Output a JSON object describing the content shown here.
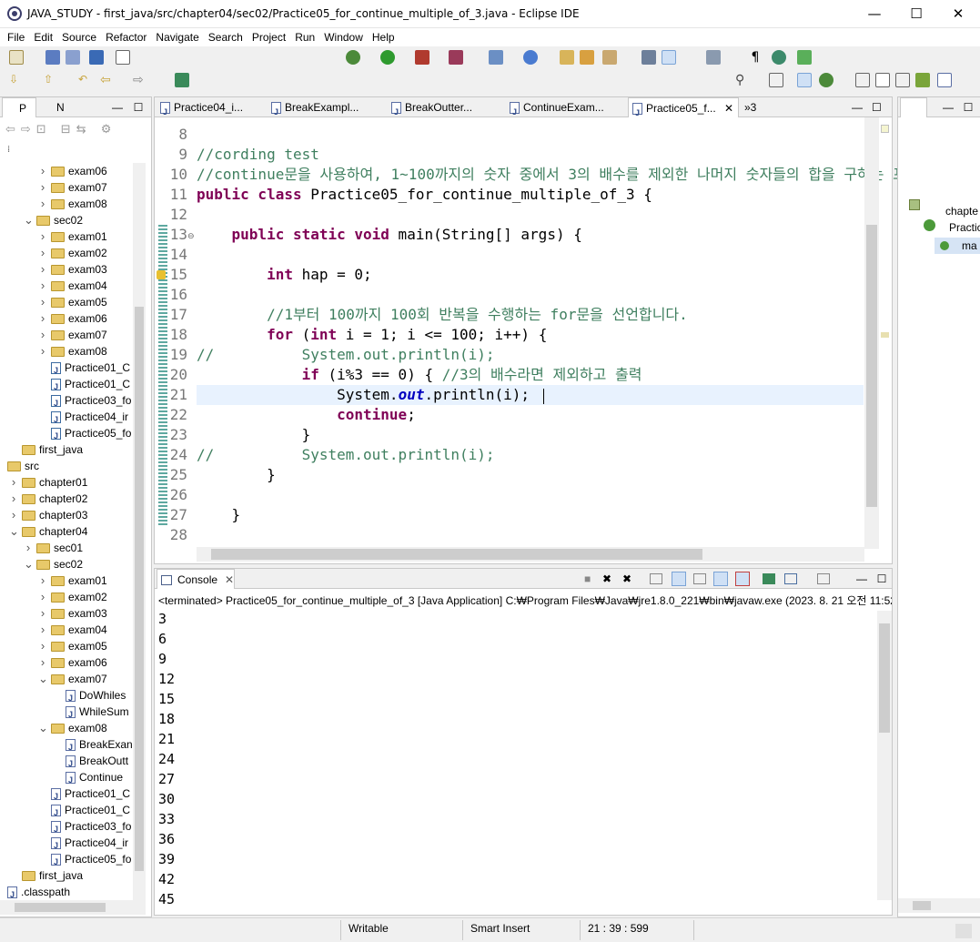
{
  "window": {
    "title": "JAVA_STUDY - first_java/src/chapter04/sec02/Practice05_for_continue_multiple_of_3.java - Eclipse IDE",
    "controls": {
      "minimize": "—",
      "maximize": "☐",
      "close": "✕"
    }
  },
  "menu": [
    "File",
    "Edit",
    "Source",
    "Refactor",
    "Navigate",
    "Search",
    "Project",
    "Run",
    "Window",
    "Help"
  ],
  "left_panel": {
    "tabs": [
      "P",
      "N"
    ],
    "tree": [
      {
        "label": "exam06",
        "type": "folder",
        "level": 3,
        "twisty": ">"
      },
      {
        "label": "exam07",
        "type": "folder",
        "level": 3,
        "twisty": ">"
      },
      {
        "label": "exam08",
        "type": "folder",
        "level": 3,
        "twisty": ">"
      },
      {
        "label": "sec02",
        "type": "folder",
        "level": 2,
        "twisty": "v"
      },
      {
        "label": "exam01",
        "type": "folder",
        "level": 3,
        "twisty": ">"
      },
      {
        "label": "exam02",
        "type": "folder",
        "level": 3,
        "twisty": ">"
      },
      {
        "label": "exam03",
        "type": "folder",
        "level": 3,
        "twisty": ">"
      },
      {
        "label": "exam04",
        "type": "folder",
        "level": 3,
        "twisty": ">"
      },
      {
        "label": "exam05",
        "type": "folder",
        "level": 3,
        "twisty": ">"
      },
      {
        "label": "exam06",
        "type": "folder",
        "level": 3,
        "twisty": ">"
      },
      {
        "label": "exam07",
        "type": "folder",
        "level": 3,
        "twisty": ">"
      },
      {
        "label": "exam08",
        "type": "folder",
        "level": 3,
        "twisty": ">"
      },
      {
        "label": "Practice01_C",
        "type": "class",
        "level": 3,
        "twisty": ""
      },
      {
        "label": "Practice01_C",
        "type": "class",
        "level": 3,
        "twisty": ""
      },
      {
        "label": "Practice03_fo",
        "type": "class",
        "level": 3,
        "twisty": ""
      },
      {
        "label": "Practice04_ir",
        "type": "class",
        "level": 3,
        "twisty": ""
      },
      {
        "label": "Practice05_fo",
        "type": "class",
        "level": 3,
        "twisty": ""
      },
      {
        "label": "first_java",
        "type": "folder",
        "level": 1,
        "twisty": ""
      },
      {
        "label": "src",
        "type": "folder",
        "level": 0,
        "twisty": ""
      },
      {
        "label": "chapter01",
        "type": "folder",
        "level": 1,
        "twisty": ">"
      },
      {
        "label": "chapter02",
        "type": "folder",
        "level": 1,
        "twisty": ">"
      },
      {
        "label": "chapter03",
        "type": "folder",
        "level": 1,
        "twisty": ">"
      },
      {
        "label": "chapter04",
        "type": "folder",
        "level": 1,
        "twisty": "v"
      },
      {
        "label": "sec01",
        "type": "folder",
        "level": 2,
        "twisty": ">"
      },
      {
        "label": "sec02",
        "type": "folder",
        "level": 2,
        "twisty": "v"
      },
      {
        "label": "exam01",
        "type": "folder",
        "level": 3,
        "twisty": ">"
      },
      {
        "label": "exam02",
        "type": "folder",
        "level": 3,
        "twisty": ">"
      },
      {
        "label": "exam03",
        "type": "folder",
        "level": 3,
        "twisty": ">"
      },
      {
        "label": "exam04",
        "type": "folder",
        "level": 3,
        "twisty": ">"
      },
      {
        "label": "exam05",
        "type": "folder",
        "level": 3,
        "twisty": ">"
      },
      {
        "label": "exam06",
        "type": "folder",
        "level": 3,
        "twisty": ">"
      },
      {
        "label": "exam07",
        "type": "folder",
        "level": 3,
        "twisty": "v"
      },
      {
        "label": "DoWhiles",
        "type": "java",
        "level": 4,
        "twisty": ""
      },
      {
        "label": "WhileSum",
        "type": "java",
        "level": 4,
        "twisty": ""
      },
      {
        "label": "exam08",
        "type": "folder",
        "level": 3,
        "twisty": "v"
      },
      {
        "label": "BreakExan",
        "type": "java",
        "level": 4,
        "twisty": ""
      },
      {
        "label": "BreakOutt",
        "type": "java",
        "level": 4,
        "twisty": ""
      },
      {
        "label": "Continue",
        "type": "java",
        "level": 4,
        "twisty": ""
      },
      {
        "label": "Practice01_C",
        "type": "java",
        "level": 3,
        "twisty": ""
      },
      {
        "label": "Practice01_C",
        "type": "java",
        "level": 3,
        "twisty": ""
      },
      {
        "label": "Practice03_fo",
        "type": "java",
        "level": 3,
        "twisty": ""
      },
      {
        "label": "Practice04_ir",
        "type": "java",
        "level": 3,
        "twisty": ""
      },
      {
        "label": "Practice05_fo",
        "type": "java",
        "level": 3,
        "twisty": ""
      },
      {
        "label": "first_java",
        "type": "folder",
        "level": 1,
        "twisty": ""
      },
      {
        "label": ".classpath",
        "type": "file",
        "level": 0,
        "twisty": ""
      }
    ]
  },
  "editor": {
    "tabs": [
      {
        "label": "Practice04_i...",
        "active": false
      },
      {
        "label": "BreakExampl...",
        "active": false
      },
      {
        "label": "BreakOutter...",
        "active": false
      },
      {
        "label": "ContinueExam...",
        "active": false
      },
      {
        "label": "Practice05_f...",
        "active": true
      }
    ],
    "overflow_count": "»3",
    "lines": [
      {
        "n": "8",
        "html": ""
      },
      {
        "n": "9",
        "html": "<span class=\"cm\">//cording test</span>"
      },
      {
        "n": "10",
        "html": "<span class=\"cm\">//continue문을 사용하여, 1~100까지의 숫자 중에서 3의 배수를 제외한 나머지 숫자들의 합을 구하는 프</span>"
      },
      {
        "n": "11",
        "html": "<span class=\"kw\">public class</span> Practice05_for_continue_multiple_of_3 {"
      },
      {
        "n": "12",
        "html": ""
      },
      {
        "n": "13",
        "html": "    <span class=\"kw\">public static void</span> main(String[] args) {"
      },
      {
        "n": "14",
        "html": ""
      },
      {
        "n": "15",
        "html": "        <span class=\"kw\">int</span> hap = 0;"
      },
      {
        "n": "16",
        "html": ""
      },
      {
        "n": "17",
        "html": "        <span class=\"cm\">//1부터 100까지 100회 반복을 수행하는 for문을 선언합니다.</span>"
      },
      {
        "n": "18",
        "html": "        <span class=\"kw\">for</span> (<span class=\"kw\">int</span> i = 1; i &lt;= 100; i++) {"
      },
      {
        "n": "19",
        "html": "<span class=\"cm\">//          System.out.println(i);</span>"
      },
      {
        "n": "20",
        "html": "            <span class=\"kw\">if</span> (i%3 == 0) { <span class=\"cm\">//3의 배수라면 제외하고 출력</span>"
      },
      {
        "n": "21",
        "html": "                System.<span class=\"fld\">out</span>.println(i);"
      },
      {
        "n": "22",
        "html": "                <span class=\"kw\">continue</span>;"
      },
      {
        "n": "23",
        "html": "            }"
      },
      {
        "n": "24",
        "html": "<span class=\"cm\">//          System.out.println(i);</span>"
      },
      {
        "n": "25",
        "html": "        }"
      },
      {
        "n": "26",
        "html": ""
      },
      {
        "n": "27",
        "html": "    }"
      },
      {
        "n": "28",
        "html": ""
      }
    ]
  },
  "outline": {
    "items": [
      "chapte",
      "Practic",
      "ma"
    ]
  },
  "console": {
    "tab": "Console",
    "status": "<terminated> Practice05_for_continue_multiple_of_3 [Java Application] C:₩Program Files₩Java₩jre1.8.0_221₩bin₩javaw.exe  (2023. 8. 21 오전 11:52",
    "output": [
      "3",
      "6",
      "9",
      "12",
      "15",
      "18",
      "21",
      "24",
      "27",
      "30",
      "33",
      "36",
      "39",
      "42",
      "45"
    ]
  },
  "status_bar": {
    "writable": "Writable",
    "insert_mode": "Smart Insert",
    "position": "21 : 39 : 599"
  },
  "colors": {
    "keyword": "#7f0055",
    "comment": "#3f7f5f",
    "field": "#0000c0",
    "highlight_line": "#e8f2fe"
  }
}
